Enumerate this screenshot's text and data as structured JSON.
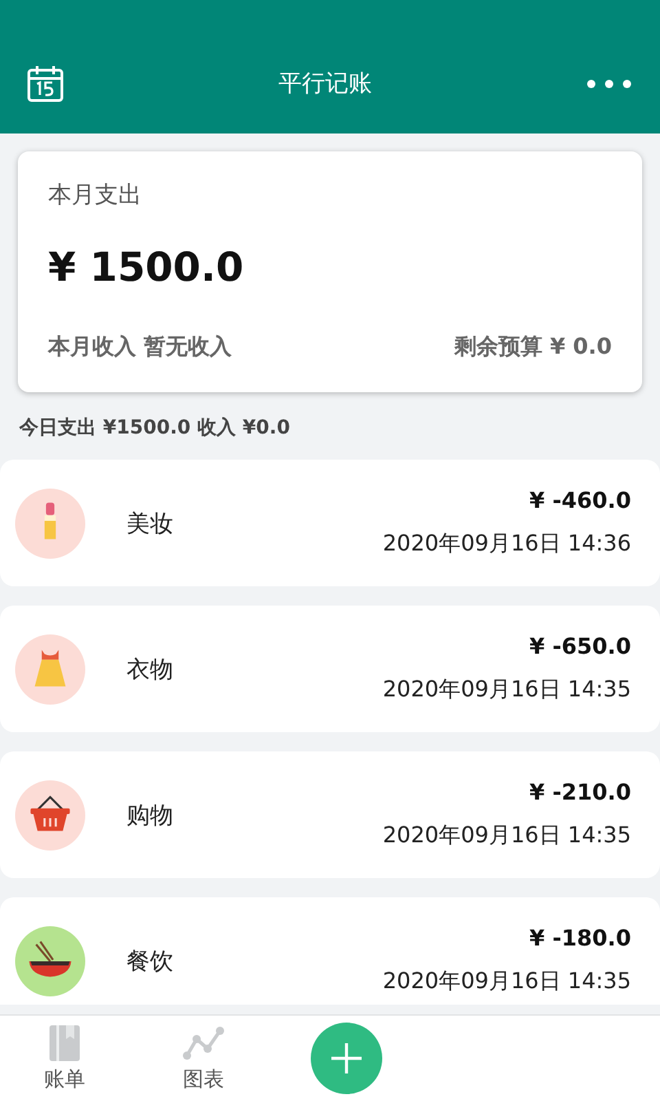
{
  "header": {
    "title": "平行记账"
  },
  "summary": {
    "label": "本月支出",
    "amount": "¥ 1500.0",
    "income": "本月收入 暂无收入",
    "budget": "剩余预算 ¥ 0.0"
  },
  "today": "今日支出 ¥1500.0 收入 ¥0.0",
  "records": [
    {
      "kind": "lipstick",
      "category": "美妆",
      "amount": "¥ -460.0",
      "time": "2020年09月16日 14:36"
    },
    {
      "kind": "dress",
      "category": "衣物",
      "amount": "¥ -650.0",
      "time": "2020年09月16日 14:35"
    },
    {
      "kind": "basket",
      "category": "购物",
      "amount": "¥ -210.0",
      "time": "2020年09月16日 14:35"
    },
    {
      "kind": "bowl",
      "category": "餐饮",
      "amount": "¥ -180.0",
      "time": "2020年09月16日 14:35"
    }
  ],
  "tabs": [
    {
      "kind": "book",
      "label": "账单"
    },
    {
      "kind": "chart",
      "label": "图表"
    },
    {
      "kind": "add"
    }
  ]
}
